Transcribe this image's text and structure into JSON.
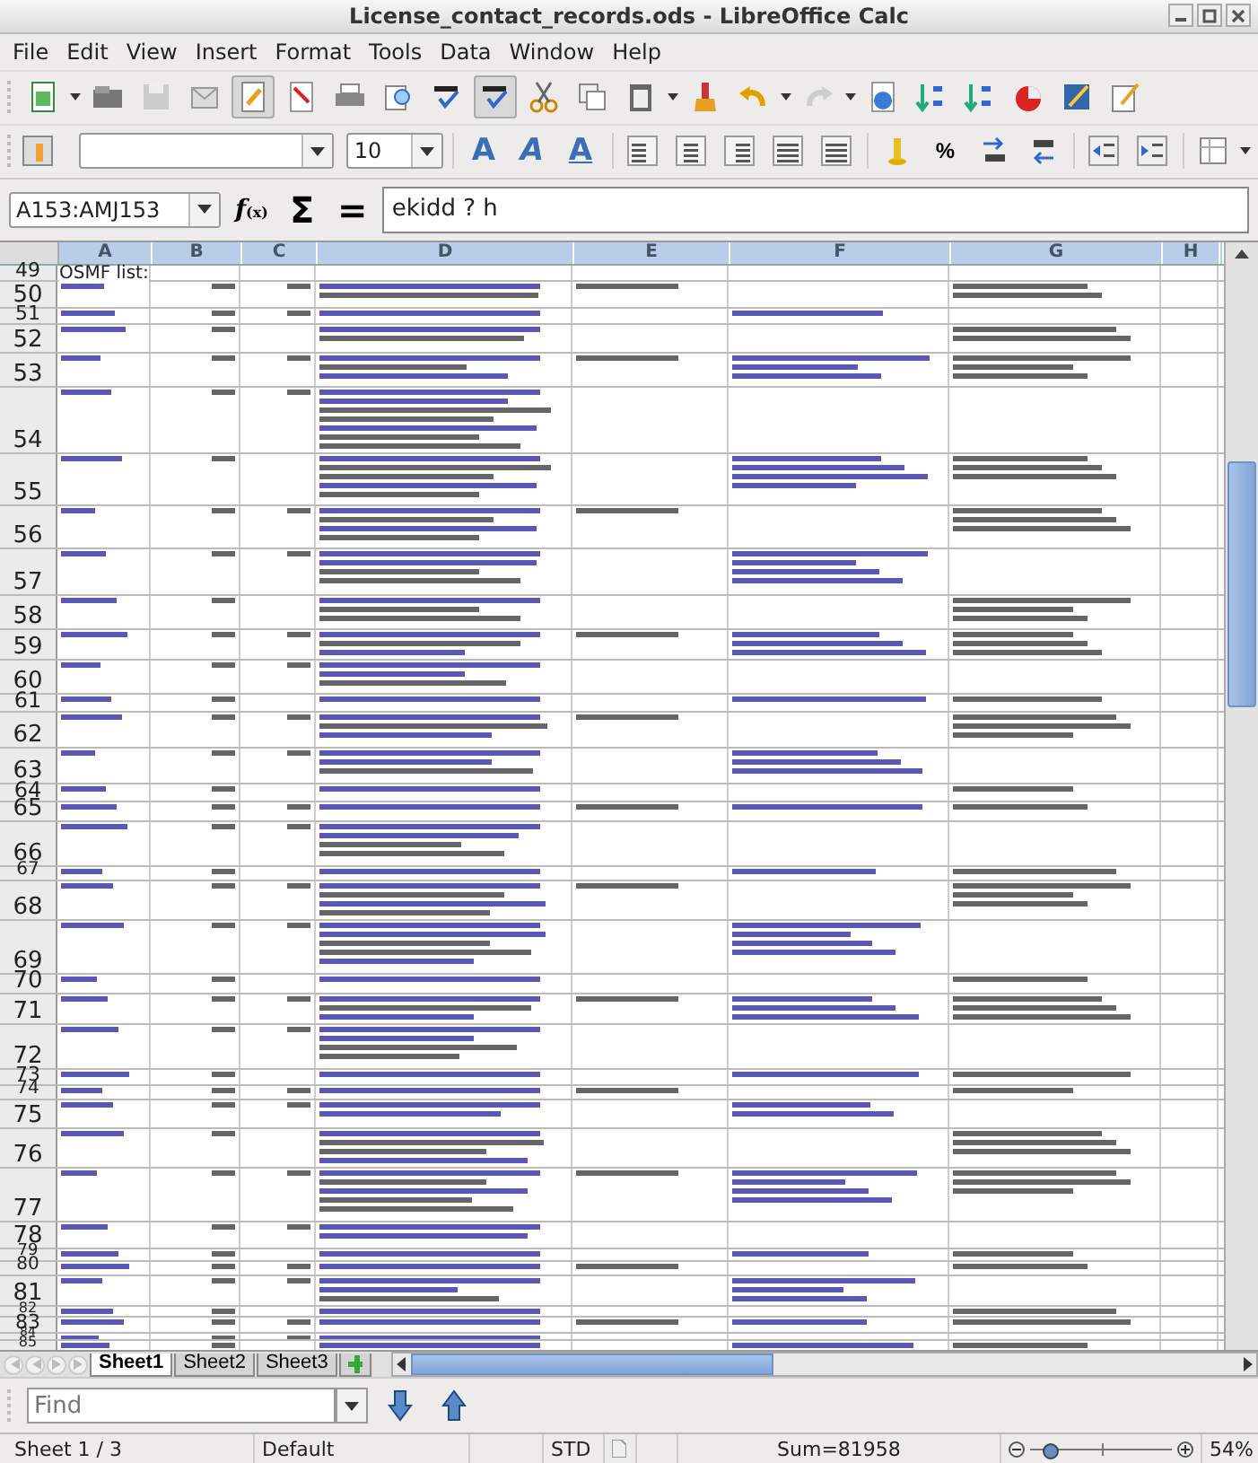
{
  "window": {
    "title": "License_contact_records.ods - LibreOffice Calc"
  },
  "menu": [
    "File",
    "Edit",
    "View",
    "Insert",
    "Format",
    "Tools",
    "Data",
    "Window",
    "Help"
  ],
  "formatting": {
    "font_size": {
      "value": "10"
    },
    "percent": "%"
  },
  "format_letters": [
    {
      "kind": "bold",
      "glyph": "A"
    },
    {
      "kind": "italic",
      "glyph": "A"
    },
    {
      "kind": "underline",
      "glyph": "A"
    }
  ],
  "formula_bar": {
    "name_box": "A153:AMJ153",
    "function_wizard": "f",
    "function_wizard_sub": "(x)",
    "sum_symbol": "Σ",
    "equals_symbol": "=",
    "content": "ekidd ? h"
  },
  "columns": [
    "A",
    "B",
    "C",
    "D",
    "E",
    "F",
    "G",
    "H"
  ],
  "rows": [
    {
      "number": "49",
      "text": "OSMF list:"
    },
    {
      "number": "50"
    },
    {
      "number": "51"
    },
    {
      "number": "52"
    },
    {
      "number": "53"
    },
    {
      "number": "54"
    },
    {
      "number": "55"
    },
    {
      "number": "56"
    },
    {
      "number": "57"
    },
    {
      "number": "58"
    },
    {
      "number": "59"
    },
    {
      "number": "60"
    },
    {
      "number": "61"
    },
    {
      "number": "62"
    },
    {
      "number": "63"
    },
    {
      "number": "64"
    },
    {
      "number": "65"
    },
    {
      "number": "66"
    },
    {
      "number": "67"
    },
    {
      "number": "68"
    },
    {
      "number": "69"
    },
    {
      "number": "70"
    },
    {
      "number": "71"
    },
    {
      "number": "72"
    },
    {
      "number": "73"
    },
    {
      "number": "74"
    },
    {
      "number": "75"
    },
    {
      "number": "76"
    },
    {
      "number": "77"
    },
    {
      "number": "78"
    },
    {
      "number": "79"
    },
    {
      "number": "80"
    },
    {
      "number": "81"
    },
    {
      "number": "82"
    },
    {
      "number": "83"
    },
    {
      "number": "84"
    },
    {
      "number": "85"
    }
  ],
  "sheet_tabs": [
    {
      "label": "Sheet1",
      "selected": true
    },
    {
      "label": "Sheet2",
      "selected": false
    },
    {
      "label": "Sheet3",
      "selected": false
    }
  ],
  "find_bar": {
    "placeholder": "Find"
  },
  "status_bar": {
    "sheet": "Sheet 1 / 3",
    "page_style": "Default",
    "mode": "STD",
    "sum": "Sum=81958",
    "zoom_slider": {
      "level": 0.13
    },
    "zoom": "54%"
  }
}
